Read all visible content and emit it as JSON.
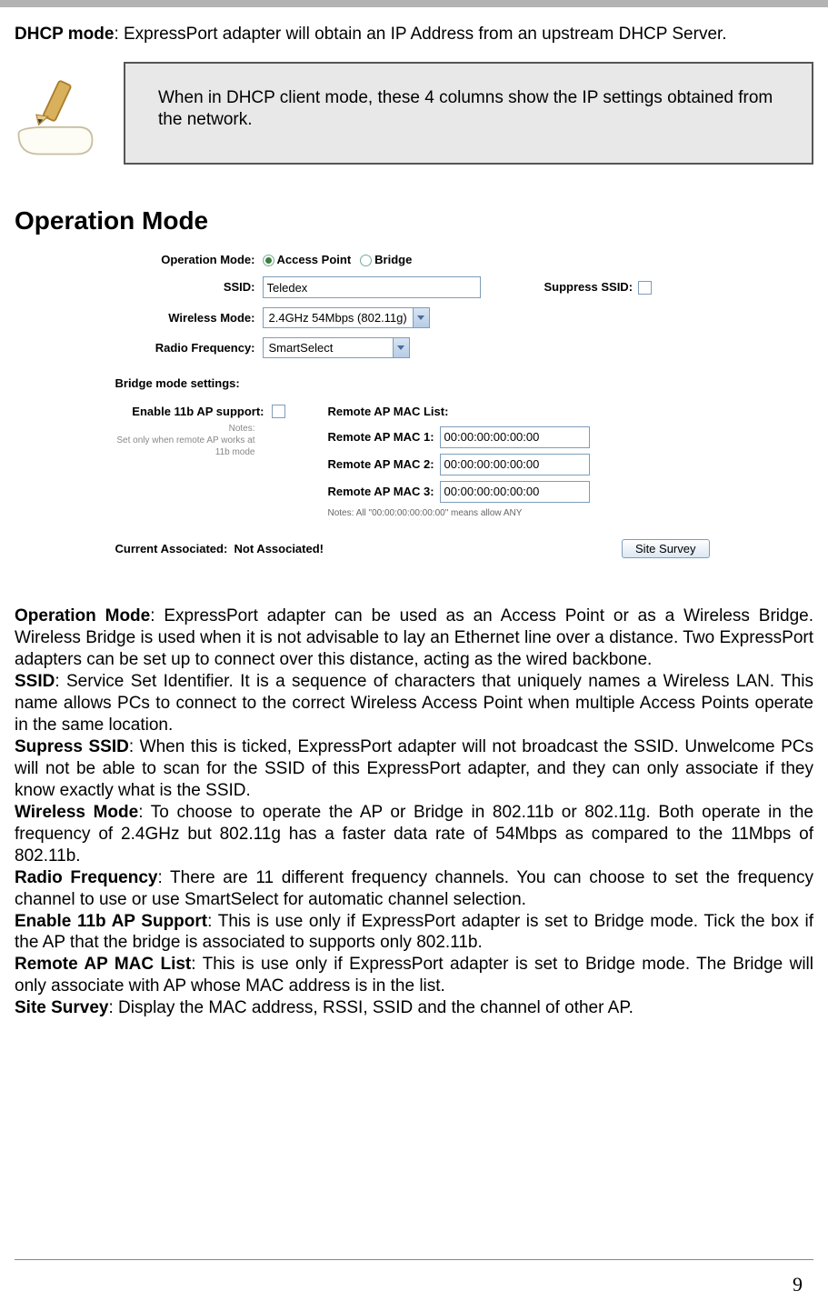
{
  "top": {
    "dhcp_label": "DHCP mode",
    "dhcp_text": ": ExpressPort adapter will obtain an IP Address from an upstream DHCP Server."
  },
  "callout": {
    "text": "When in DHCP client mode, these 4 columns show the IP settings obtained from the network."
  },
  "heading": "Operation Mode",
  "ss": {
    "op_mode_label": "Operation Mode:",
    "op_ap": "Access Point",
    "op_bridge": "Bridge",
    "ssid_label": "SSID:",
    "ssid_value": "Teledex",
    "suppress_label": "Suppress SSID:",
    "wmode_label": "Wireless Mode:",
    "wmode_value": "2.4GHz 54Mbps (802.11g)",
    "rf_label": "Radio Frequency:",
    "rf_value": "SmartSelect",
    "bridge_head": "Bridge mode settings:",
    "en11b_label": "Enable 11b AP support:",
    "notes_label": "Notes:",
    "notes_text": "Set only when remote AP works at 11b mode",
    "maclist_label": "Remote AP MAC List:",
    "mac1_label": "Remote AP MAC 1:",
    "mac2_label": "Remote AP MAC 2:",
    "mac3_label": "Remote AP MAC 3:",
    "mac_value": "00:00:00:00:00:00",
    "mac_note": "Notes: All \"00:00:00:00:00:00\" means allow ANY",
    "assoc_label": "Current Associated:",
    "assoc_value": "Not Associated!",
    "survey_btn": "Site Survey"
  },
  "body": {
    "opmode_b": "Operation Mode",
    "opmode_t": ": ExpressPort adapter can be used as an Access Point or as a Wireless Bridge. Wireless Bridge is used when it is not advisable to lay an Ethernet line over a distance. Two ExpressPort adapters can be set up to connect over this distance, acting as the wired backbone.",
    "ssid_b": "SSID",
    "ssid_t": ": Service Set Identifier. It is a sequence of characters that uniquely names a Wireless LAN. This name allows PCs to connect to the correct Wireless Access Point when multiple Access Points operate in the same location.",
    "sup_b": "Supress SSID",
    "sup_t": ": When this is ticked, ExpressPort adapter will not broadcast the SSID. Unwelcome PCs will not be able to scan for the SSID of this ExpressPort adapter, and they can only associate if they know exactly what is the SSID.",
    "wm_b": "Wireless Mode",
    "wm_t": ": To choose to operate the AP or Bridge in 802.11b or 802.11g. Both operate in the frequency of 2.4GHz but 802.11g has a faster data rate of 54Mbps as compared to the 11Mbps of 802.11b.",
    "rf_b": "Radio Frequency",
    "rf_t": ": There are 11 different frequency channels. You can choose to set the frequency channel to use or use SmartSelect for automatic channel selection.",
    "e11b_b": "Enable 11b AP Support",
    "e11b_t": ": This is use only if ExpressPort adapter is set to Bridge mode. Tick the box if the AP that the bridge is associated to supports only 802.11b.",
    "mac_b": "Remote AP MAC List",
    "mac_t": ": This is use only if ExpressPort adapter is set to Bridge mode. The Bridge will only associate with AP whose MAC address is in the list.",
    "ss_b": "Site Survey",
    "ss_t": ": Display the MAC address, RSSI, SSID and the channel of other AP."
  },
  "page_number": "9"
}
